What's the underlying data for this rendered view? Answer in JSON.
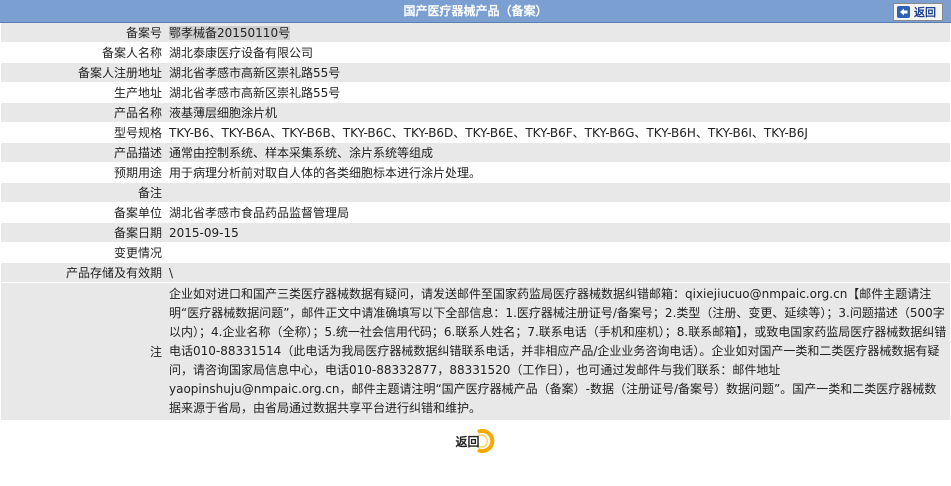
{
  "header": {
    "title": "国产医疗器械产品（备案）",
    "back_label": "返回"
  },
  "rows": [
    {
      "label": "备案号",
      "value": "鄂孝械备20150110号"
    },
    {
      "label": "备案人名称",
      "value": "湖北泰康医疗设备有限公司"
    },
    {
      "label": "备案人注册地址",
      "value": "湖北省孝感市高新区崇礼路55号"
    },
    {
      "label": "生产地址",
      "value": "湖北省孝感市高新区崇礼路55号"
    },
    {
      "label": "产品名称",
      "value": "液基薄层细胞涂片机"
    },
    {
      "label": "型号规格",
      "value": "TKY-B6、TKY-B6A、TKY-B6B、TKY-B6C、TKY-B6D、TKY-B6E、TKY-B6F、TKY-B6G、TKY-B6H、TKY-B6I、TKY-B6J"
    },
    {
      "label": "产品描述",
      "value": "通常由控制系统、样本采集系统、涂片系统等组成"
    },
    {
      "label": "预期用途",
      "value": "用于病理分析前对取自人体的各类细胞标本进行涂片处理。"
    },
    {
      "label": "备注",
      "value": ""
    },
    {
      "label": "备案单位",
      "value": "湖北省孝感市食品药品监督管理局"
    },
    {
      "label": "备案日期",
      "value": "2015-09-15"
    },
    {
      "label": "变更情况",
      "value": ""
    },
    {
      "label": "产品存储及有效期",
      "value": "\\"
    }
  ],
  "note": {
    "label": "注",
    "text": "企业如对进口和国产三类医疗器械数据有疑问，请发送邮件至国家药监局医疗器械数据纠错邮箱：qixiejiucuo@nmpaic.org.cn【邮件主题请注明“医疗器械数据问题”，邮件正文中请准确填写以下全部信息：1.医疗器械注册证号/备案号；2.类型（注册、变更、延续等）；3.问题描述（500字以内）；4.企业名称（全称）；5.统一社会信用代码；6.联系人姓名；7.联系电话（手机和座机）；8.联系邮箱】，或致电国家药监局医疗器械数据纠错电话010-88331514（此电话为我局医疗器械数据纠错联系电话，并非相应产品/企业业务咨询电话）。企业如对国产一类和二类医疗器械数据有疑问，请咨询国家局信息中心，电话010-88332877，88331520（工作日），也可通过发邮件与我们联系：邮件地址yaopinshuju@nmpaic.org.cn，邮件主题请注明“国产医疗器械产品（备案）-数据（注册证号/备案号）数据问题”。国产一类和二类医疗器械数据来源于省局，由省局通过数据共享平台进行纠错和维护。"
  },
  "footer": {
    "back_label": "返回"
  },
  "icons": {
    "top_back": "back-arrow-icon",
    "bottom_back": "circle-arrow-icon"
  },
  "colors": {
    "header_bg": "#7a9fd0",
    "row_alt": "#e8e8e8",
    "accent": "#f5a800"
  }
}
